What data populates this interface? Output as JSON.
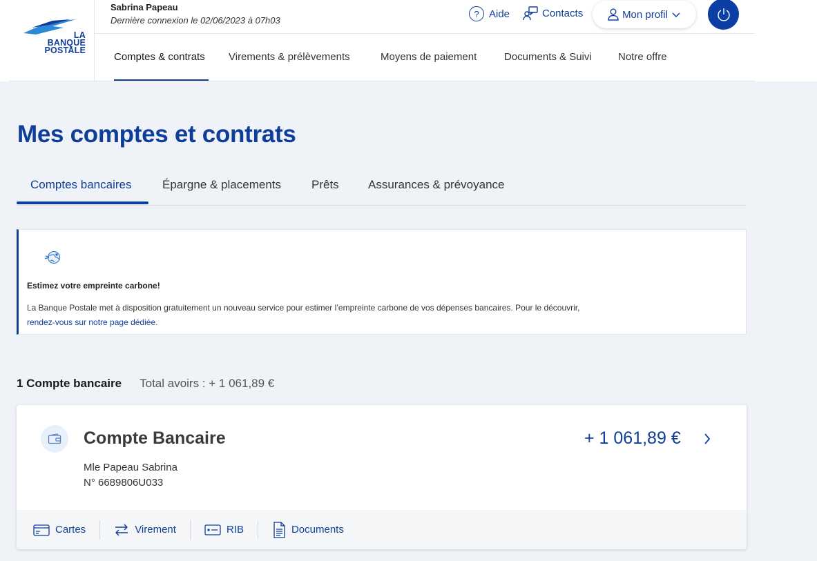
{
  "header": {
    "logo": {
      "line1": "LA",
      "line2": "BANQUE",
      "line3": "POSTALE",
      "icon": "la-banque-postale-bird-logo"
    },
    "user_name": "Sabrina Papeau",
    "last_login": "Dernière connexion le 02/06/2023 à 07h03",
    "aide_label": "Aide",
    "contacts_label": "Contacts",
    "profil_label": "Mon profil",
    "power_icon": "power-icon"
  },
  "main_nav": [
    {
      "label": "Comptes & contrats",
      "active": true
    },
    {
      "label": "Virements & prélèvements"
    },
    {
      "label": "Moyens de paiement"
    },
    {
      "label": "Documents & Suivi"
    },
    {
      "label": "Notre offre"
    }
  ],
  "page": {
    "title": "Mes comptes et contrats",
    "tabs": [
      {
        "label": "Comptes bancaires",
        "active": true
      },
      {
        "label": "Épargne & placements"
      },
      {
        "label": "Prêts"
      },
      {
        "label": "Assurances & prévoyance"
      }
    ]
  },
  "notice": {
    "icon": "earth-carbon-icon",
    "title": "Estimez votre empreinte carbone!",
    "body": "La Banque Postale met à disposition gratuitement un nouveau service pour estimer l’empreinte carbone de vos dépenses bancaires. Pour le découvrir,",
    "link": "rendez-vous sur notre page dédiée."
  },
  "summary": {
    "count": "1 Compte bancaire",
    "total": "Total avoirs : + 1 061,89 €"
  },
  "account": {
    "icon": "wallet-icon",
    "name": "Compte Bancaire",
    "holder": "Mle Papeau Sabrina",
    "number": "N° 6689806U033",
    "balance": "+ 1 061,89 €",
    "actions": {
      "cartes": "Cartes",
      "virement": "Virement",
      "rib": "RIB",
      "documents": "Documents"
    }
  },
  "colors": {
    "brand": "#0f3e99",
    "background": "#eff2f6"
  }
}
